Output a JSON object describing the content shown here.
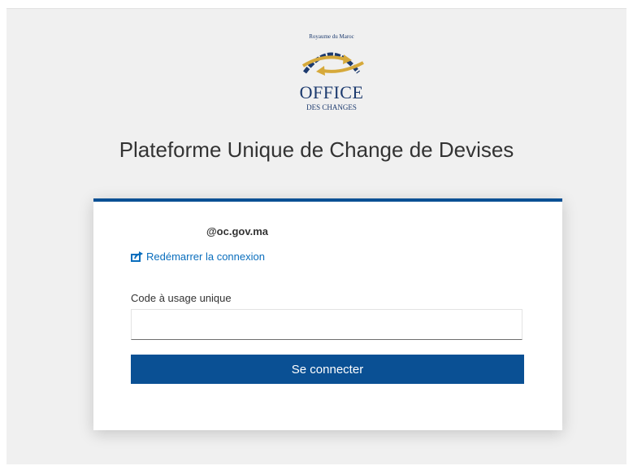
{
  "logo": {
    "kingdom": "Royaume du Maroc",
    "office": "OFFICE",
    "changes": "DES CHANGES",
    "colors": {
      "navy": "#1c3a6e",
      "gold": "#d6a93a"
    }
  },
  "page": {
    "title": "Plateforme Unique de Change de Devises"
  },
  "login": {
    "account": "@oc.gov.ma",
    "restart_link": "Redémarrer la connexion",
    "otp_label": "Code à usage unique",
    "otp_value": "",
    "submit_label": "Se connecter",
    "accent_color": "#0a5094",
    "link_color": "#0a6ebd"
  }
}
